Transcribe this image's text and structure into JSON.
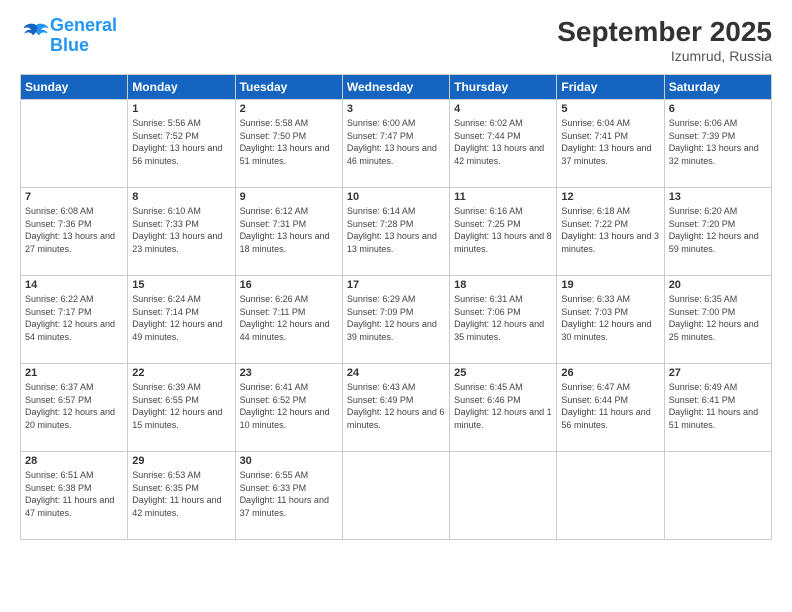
{
  "logo": {
    "line1": "General",
    "line2": "Blue"
  },
  "title": "September 2025",
  "location": "Izumrud, Russia",
  "days_of_week": [
    "Sunday",
    "Monday",
    "Tuesday",
    "Wednesday",
    "Thursday",
    "Friday",
    "Saturday"
  ],
  "weeks": [
    [
      {
        "day": "",
        "sunrise": "",
        "sunset": "",
        "daylight": ""
      },
      {
        "day": "1",
        "sunrise": "Sunrise: 5:56 AM",
        "sunset": "Sunset: 7:52 PM",
        "daylight": "Daylight: 13 hours and 56 minutes."
      },
      {
        "day": "2",
        "sunrise": "Sunrise: 5:58 AM",
        "sunset": "Sunset: 7:50 PM",
        "daylight": "Daylight: 13 hours and 51 minutes."
      },
      {
        "day": "3",
        "sunrise": "Sunrise: 6:00 AM",
        "sunset": "Sunset: 7:47 PM",
        "daylight": "Daylight: 13 hours and 46 minutes."
      },
      {
        "day": "4",
        "sunrise": "Sunrise: 6:02 AM",
        "sunset": "Sunset: 7:44 PM",
        "daylight": "Daylight: 13 hours and 42 minutes."
      },
      {
        "day": "5",
        "sunrise": "Sunrise: 6:04 AM",
        "sunset": "Sunset: 7:41 PM",
        "daylight": "Daylight: 13 hours and 37 minutes."
      },
      {
        "day": "6",
        "sunrise": "Sunrise: 6:06 AM",
        "sunset": "Sunset: 7:39 PM",
        "daylight": "Daylight: 13 hours and 32 minutes."
      }
    ],
    [
      {
        "day": "7",
        "sunrise": "Sunrise: 6:08 AM",
        "sunset": "Sunset: 7:36 PM",
        "daylight": "Daylight: 13 hours and 27 minutes."
      },
      {
        "day": "8",
        "sunrise": "Sunrise: 6:10 AM",
        "sunset": "Sunset: 7:33 PM",
        "daylight": "Daylight: 13 hours and 23 minutes."
      },
      {
        "day": "9",
        "sunrise": "Sunrise: 6:12 AM",
        "sunset": "Sunset: 7:31 PM",
        "daylight": "Daylight: 13 hours and 18 minutes."
      },
      {
        "day": "10",
        "sunrise": "Sunrise: 6:14 AM",
        "sunset": "Sunset: 7:28 PM",
        "daylight": "Daylight: 13 hours and 13 minutes."
      },
      {
        "day": "11",
        "sunrise": "Sunrise: 6:16 AM",
        "sunset": "Sunset: 7:25 PM",
        "daylight": "Daylight: 13 hours and 8 minutes."
      },
      {
        "day": "12",
        "sunrise": "Sunrise: 6:18 AM",
        "sunset": "Sunset: 7:22 PM",
        "daylight": "Daylight: 13 hours and 3 minutes."
      },
      {
        "day": "13",
        "sunrise": "Sunrise: 6:20 AM",
        "sunset": "Sunset: 7:20 PM",
        "daylight": "Daylight: 12 hours and 59 minutes."
      }
    ],
    [
      {
        "day": "14",
        "sunrise": "Sunrise: 6:22 AM",
        "sunset": "Sunset: 7:17 PM",
        "daylight": "Daylight: 12 hours and 54 minutes."
      },
      {
        "day": "15",
        "sunrise": "Sunrise: 6:24 AM",
        "sunset": "Sunset: 7:14 PM",
        "daylight": "Daylight: 12 hours and 49 minutes."
      },
      {
        "day": "16",
        "sunrise": "Sunrise: 6:26 AM",
        "sunset": "Sunset: 7:11 PM",
        "daylight": "Daylight: 12 hours and 44 minutes."
      },
      {
        "day": "17",
        "sunrise": "Sunrise: 6:29 AM",
        "sunset": "Sunset: 7:09 PM",
        "daylight": "Daylight: 12 hours and 39 minutes."
      },
      {
        "day": "18",
        "sunrise": "Sunrise: 6:31 AM",
        "sunset": "Sunset: 7:06 PM",
        "daylight": "Daylight: 12 hours and 35 minutes."
      },
      {
        "day": "19",
        "sunrise": "Sunrise: 6:33 AM",
        "sunset": "Sunset: 7:03 PM",
        "daylight": "Daylight: 12 hours and 30 minutes."
      },
      {
        "day": "20",
        "sunrise": "Sunrise: 6:35 AM",
        "sunset": "Sunset: 7:00 PM",
        "daylight": "Daylight: 12 hours and 25 minutes."
      }
    ],
    [
      {
        "day": "21",
        "sunrise": "Sunrise: 6:37 AM",
        "sunset": "Sunset: 6:57 PM",
        "daylight": "Daylight: 12 hours and 20 minutes."
      },
      {
        "day": "22",
        "sunrise": "Sunrise: 6:39 AM",
        "sunset": "Sunset: 6:55 PM",
        "daylight": "Daylight: 12 hours and 15 minutes."
      },
      {
        "day": "23",
        "sunrise": "Sunrise: 6:41 AM",
        "sunset": "Sunset: 6:52 PM",
        "daylight": "Daylight: 12 hours and 10 minutes."
      },
      {
        "day": "24",
        "sunrise": "Sunrise: 6:43 AM",
        "sunset": "Sunset: 6:49 PM",
        "daylight": "Daylight: 12 hours and 6 minutes."
      },
      {
        "day": "25",
        "sunrise": "Sunrise: 6:45 AM",
        "sunset": "Sunset: 6:46 PM",
        "daylight": "Daylight: 12 hours and 1 minute."
      },
      {
        "day": "26",
        "sunrise": "Sunrise: 6:47 AM",
        "sunset": "Sunset: 6:44 PM",
        "daylight": "Daylight: 11 hours and 56 minutes."
      },
      {
        "day": "27",
        "sunrise": "Sunrise: 6:49 AM",
        "sunset": "Sunset: 6:41 PM",
        "daylight": "Daylight: 11 hours and 51 minutes."
      }
    ],
    [
      {
        "day": "28",
        "sunrise": "Sunrise: 6:51 AM",
        "sunset": "Sunset: 6:38 PM",
        "daylight": "Daylight: 11 hours and 47 minutes."
      },
      {
        "day": "29",
        "sunrise": "Sunrise: 6:53 AM",
        "sunset": "Sunset: 6:35 PM",
        "daylight": "Daylight: 11 hours and 42 minutes."
      },
      {
        "day": "30",
        "sunrise": "Sunrise: 6:55 AM",
        "sunset": "Sunset: 6:33 PM",
        "daylight": "Daylight: 11 hours and 37 minutes."
      },
      {
        "day": "",
        "sunrise": "",
        "sunset": "",
        "daylight": ""
      },
      {
        "day": "",
        "sunrise": "",
        "sunset": "",
        "daylight": ""
      },
      {
        "day": "",
        "sunrise": "",
        "sunset": "",
        "daylight": ""
      },
      {
        "day": "",
        "sunrise": "",
        "sunset": "",
        "daylight": ""
      }
    ]
  ]
}
